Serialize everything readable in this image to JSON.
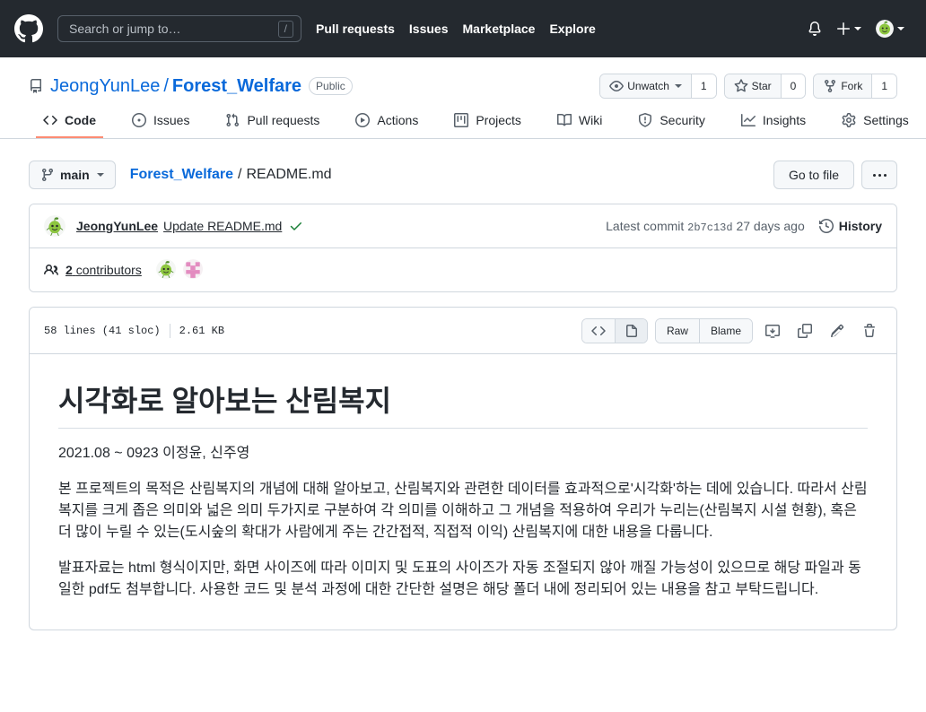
{
  "header": {
    "logo_icon": "github-mark-icon",
    "search": {
      "placeholder": "Search or jump to…",
      "shortcut_key": "/"
    },
    "nav": [
      {
        "label": "Pull requests"
      },
      {
        "label": "Issues"
      },
      {
        "label": "Marketplace"
      },
      {
        "label": "Explore"
      }
    ],
    "notifications_icon": "bell-icon",
    "create_new_icon": "plus-icon",
    "account_icon": "user-avatar"
  },
  "repo": {
    "repo_icon": "repo-book-icon",
    "owner": "JeongYunLee",
    "separator": "/",
    "name": "Forest_Welfare",
    "visibility": "Public",
    "actions": [
      {
        "icon": "eye-icon",
        "label": "Unwatch",
        "count": "1",
        "has_caret": true
      },
      {
        "icon": "star-icon",
        "label": "Star",
        "count": "0",
        "has_caret": false
      },
      {
        "icon": "fork-icon",
        "label": "Fork",
        "count": "1",
        "has_caret": false
      }
    ],
    "tabs": [
      {
        "label": "Code",
        "icon": "code-icon",
        "selected": true
      },
      {
        "label": "Issues",
        "icon": "issue-opened-icon",
        "selected": false
      },
      {
        "label": "Pull requests",
        "icon": "git-pull-request-icon",
        "selected": false
      },
      {
        "label": "Actions",
        "icon": "play-icon",
        "selected": false
      },
      {
        "label": "Projects",
        "icon": "project-board-icon",
        "selected": false
      },
      {
        "label": "Wiki",
        "icon": "book-icon",
        "selected": false
      },
      {
        "label": "Security",
        "icon": "shield-icon",
        "selected": false
      },
      {
        "label": "Insights",
        "icon": "graph-icon",
        "selected": false
      },
      {
        "label": "Settings",
        "icon": "gear-icon",
        "selected": false
      }
    ]
  },
  "file_nav": {
    "branch_icon": "git-branch-icon",
    "branch_name": "main",
    "breadcrumb_repo": "Forest_Welfare",
    "breadcrumb_sep": "/",
    "breadcrumb_file": "README.md",
    "go_to_file_label": "Go to file",
    "kebab_label": "…"
  },
  "commit": {
    "author_avatar": "green-sprout-avatar",
    "author": "JeongYunLee",
    "message": "Update README.md",
    "status_icon": "check-icon",
    "latest_commit_prefix": "Latest commit",
    "sha": "2b7c13d",
    "relative_time": "27 days ago",
    "history_icon": "history-icon",
    "history_label": "History"
  },
  "contributors": {
    "people_icon": "people-icon",
    "count": "2",
    "label": "contributors",
    "avatars": [
      "green-sprout-avatar",
      "pink-identicon-avatar"
    ]
  },
  "file_toolbar": {
    "lines": "58 lines (41 sloc)",
    "size": "2.61 KB",
    "view_code_icon": "code-brackets-icon",
    "view_preview_icon": "file-icon",
    "raw_label": "Raw",
    "blame_label": "Blame",
    "open_desktop_icon": "desktop-download-icon",
    "copy_icon": "copy-icon",
    "edit_icon": "pencil-icon",
    "delete_icon": "trash-icon"
  },
  "readme": {
    "title": "시각화로 알아보는 산림복지",
    "subtitle": "2021.08 ~ 0923 이정윤, 신주영",
    "paragraph_1": "본 프로젝트의 목적은 산림복지의 개념에 대해 알아보고, 산림복지와 관련한 데이터를 효과적으로'시각화'하는 데에 있습니다. 따라서 산림복지를 크게 좁은 의미와 넓은 의미 두가지로 구분하여 각 의미를 이해하고 그 개념을 적용하여 우리가 누리는(산림복지 시설 현황), 혹은 더 많이 누릴 수 있는(도시숲의 확대가 사람에게 주는 간간접적, 직접적 이익) 산림복지에 대한 내용을 다룹니다.",
    "paragraph_2": "발표자료는 html 형식이지만, 화면 사이즈에 따라 이미지 및 도표의 사이즈가 자동 조절되지 않아 깨질 가능성이 있으므로 해당 파일과 동일한 pdf도 첨부합니다. 사용한 코드 및 분석 과정에 대한 간단한 설명은 해당 폴더 내에 정리되어 있는 내용을 참고 부탁드립니다."
  },
  "colors": {
    "header_bg": "#24292f",
    "link_blue": "#0969da",
    "border": "#d0d7de",
    "muted_text": "#57606a",
    "selected_tab_underline": "#fd8c73",
    "success_green": "#1a7f37"
  }
}
